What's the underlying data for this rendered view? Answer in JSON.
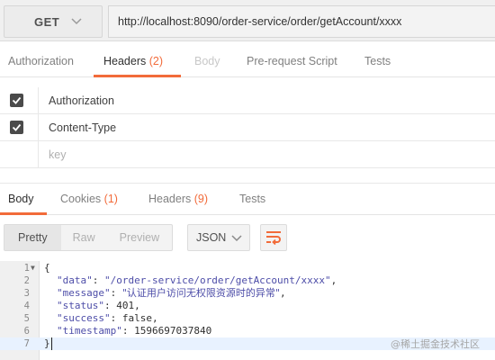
{
  "request": {
    "method": "GET",
    "url": "http://localhost:8090/order-service/order/getAccount/xxxx"
  },
  "request_tabs": [
    {
      "label": "Authorization",
      "count": ""
    },
    {
      "label": "Headers",
      "count": "(2)"
    },
    {
      "label": "Body",
      "count": ""
    },
    {
      "label": "Pre-request Script",
      "count": ""
    },
    {
      "label": "Tests",
      "count": ""
    }
  ],
  "headers": [
    {
      "key": "Authorization",
      "checked": true
    },
    {
      "key": "Content-Type",
      "checked": true
    }
  ],
  "new_header_placeholder": "key",
  "response_tabs": [
    {
      "label": "Body",
      "count": ""
    },
    {
      "label": "Cookies",
      "count": "(1)"
    },
    {
      "label": "Headers",
      "count": "(9)"
    },
    {
      "label": "Tests",
      "count": ""
    }
  ],
  "view_modes": [
    "Pretty",
    "Raw",
    "Preview"
  ],
  "format": "JSON",
  "code_lines": [
    {
      "num": "1",
      "p1": "{"
    },
    {
      "num": "2",
      "key": "\"data\"",
      "sep": ": ",
      "val": "\"/order-service/order/getAccount/xxxx\"",
      "end": ","
    },
    {
      "num": "3",
      "key": "\"message\"",
      "sep": ": ",
      "val": "\"认证用户访问无权限资源时的异常\"",
      "end": ","
    },
    {
      "num": "4",
      "key": "\"status\"",
      "sep": ": ",
      "val": "401",
      "end": ","
    },
    {
      "num": "5",
      "key": "\"success\"",
      "sep": ": ",
      "val": "false",
      "end": ","
    },
    {
      "num": "6",
      "key": "\"timestamp\"",
      "sep": ": ",
      "val": "1596697037840",
      "end": ""
    },
    {
      "num": "7",
      "p1": "}"
    }
  ],
  "watermark": "@稀土掘金技术社区",
  "colors": {
    "accent": "#f26b3a",
    "json_text": "#4d4da8"
  }
}
